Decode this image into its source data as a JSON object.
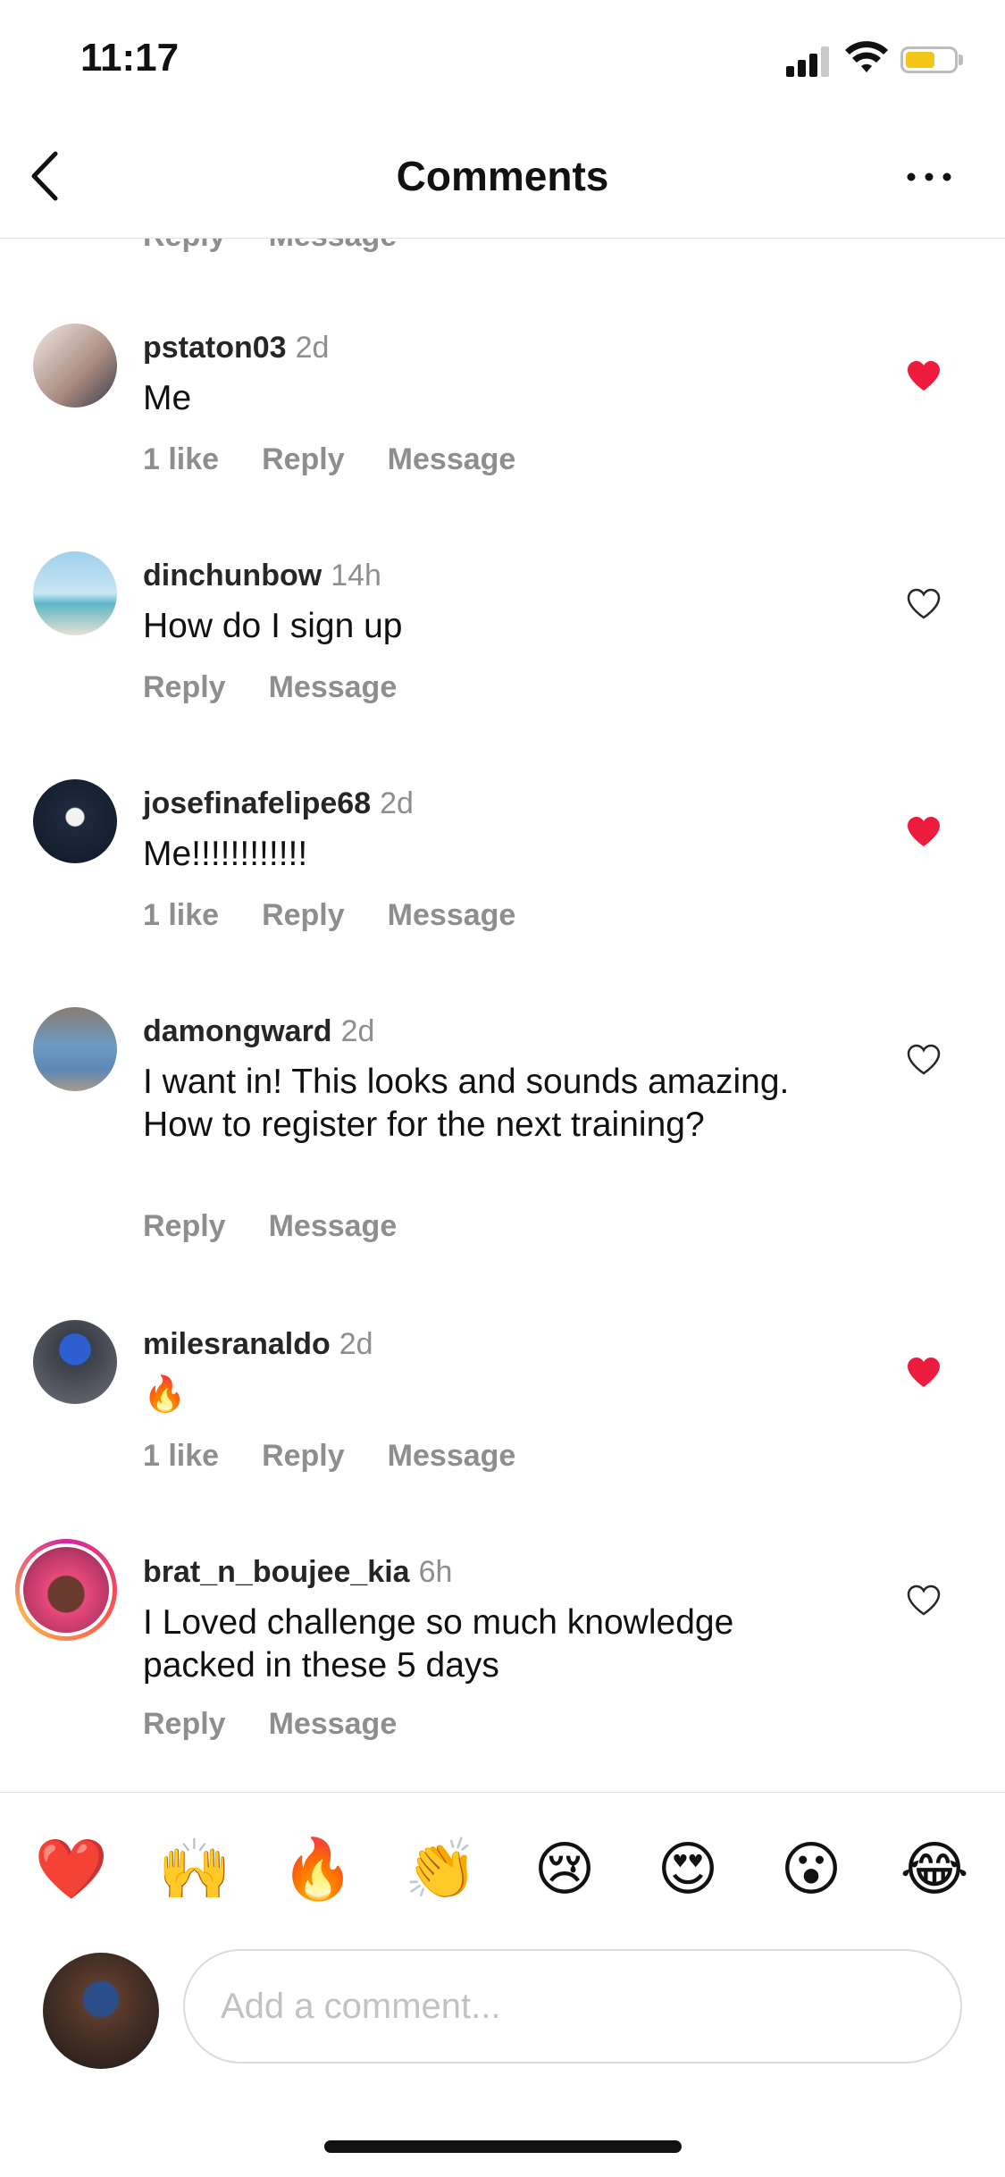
{
  "status_bar": {
    "time": "11:17",
    "battery_color": "#f5c518"
  },
  "header": {
    "title": "Comments",
    "back_icon": "chevron-left-icon",
    "more_icon": "more-horizontal-icon"
  },
  "partial_row": {
    "reply": "Reply",
    "message": "Message"
  },
  "comments": [
    {
      "username": "pstaton03",
      "time": "2d",
      "text": "Me",
      "likes": "1 like",
      "reply": "Reply",
      "message": "Message",
      "liked": true
    },
    {
      "username": "dinchunbow",
      "time": "14h",
      "text": "How do I sign up",
      "reply": "Reply",
      "message": "Message",
      "liked": false
    },
    {
      "username": "josefinafelipe68",
      "time": "2d",
      "text": "Me!!!!!!!!!!!!",
      "likes": "1 like",
      "reply": "Reply",
      "message": "Message",
      "liked": true
    },
    {
      "username": "damongward",
      "time": "2d",
      "text": "I want in! This looks and sounds amazing. How to register for the next training?",
      "reply": "Reply",
      "message": "Message",
      "liked": false
    },
    {
      "username": "milesranaldo",
      "time": "2d",
      "text": "🔥",
      "likes": "1 like",
      "reply": "Reply",
      "message": "Message",
      "liked": true
    },
    {
      "username": "brat_n_boujee_kia",
      "time": "6h",
      "text": "I Loved challenge so much knowledge packed in these 5 days",
      "reply": "Reply",
      "message": "Message",
      "liked": false
    }
  ],
  "emoji_bar": [
    "❤️",
    "🙌",
    "🔥",
    "👏",
    "😢",
    "😍",
    "😮",
    "😂"
  ],
  "composer": {
    "placeholder": "Add a comment..."
  },
  "colors": {
    "liked_heart": "#ed1c3f",
    "secondary_text": "#8e8e8e",
    "story_ring": "#d6249f"
  }
}
